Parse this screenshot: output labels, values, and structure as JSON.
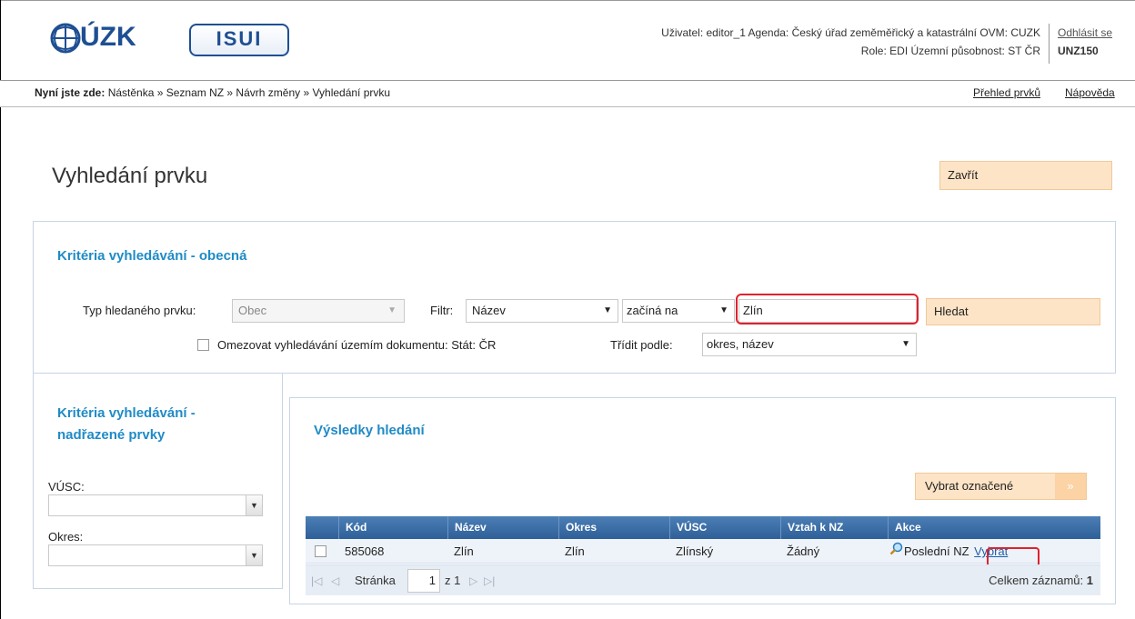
{
  "header": {
    "logo_cuzk": "ÚZK",
    "logo_isui": "ISUI",
    "user_line1": "Uživatel: editor_1  Agenda: Český úřad zeměměřický a katastrální  OVM: CUZK",
    "user_line2": "Role: EDI  Územní působnost: ST ČR",
    "logout": "Odhlásit se",
    "session_code": "UNZ150"
  },
  "breadcrumb": {
    "prefix": "Nyní jste zde:",
    "path": "Nástěnka » Seznam NZ » Návrh změny » Vyhledání prvku",
    "link_overview": "Přehled prvků",
    "link_help": "Nápověda"
  },
  "page": {
    "title": "Vyhledání prvku",
    "close_label": "Zavřít"
  },
  "general": {
    "title": "Kritéria vyhledávání - obecná",
    "type_label": "Typ hledaného prvku:",
    "type_value": "Obec",
    "filter_label": "Filtr:",
    "filter_field": "Název",
    "filter_op": "začíná na",
    "search_value": "Zlín",
    "search_label": "Hledat",
    "limit_label": "Omezovat vyhledávání územím dokumentu: Stát: ČR",
    "sort_label": "Třídit podle:",
    "sort_value": "okres, název"
  },
  "parent": {
    "title": "Kritéria vyhledávání - nadřazené prvky",
    "vusc_label": "VÚSC:",
    "okres_label": "Okres:"
  },
  "results": {
    "title": "Výsledky hledání",
    "select_marked": "Vybrat označené",
    "columns": [
      "Kód",
      "Název",
      "Okres",
      "VÚSC",
      "Vztah k NZ",
      "Akce"
    ],
    "rows": [
      {
        "kod": "585068",
        "nazev": "Zlín",
        "okres": "Zlín",
        "vusc": "Zlínský",
        "vztah": "Žádný",
        "akce_last": "Poslední NZ",
        "akce_select": "Vybrat"
      }
    ],
    "pager": {
      "page_label": "Stránka",
      "page_value": "1",
      "of_text": "z 1",
      "total_label": "Celkem záznamů:",
      "total_value": "1"
    }
  }
}
